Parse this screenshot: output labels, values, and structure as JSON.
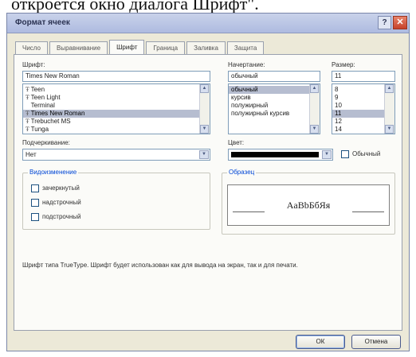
{
  "caption": "откроется окно диалога Шрифт\".",
  "window": {
    "title": "Формат ячеек",
    "help_glyph": "?",
    "close_glyph": "✕"
  },
  "tabs": [
    {
      "label": "Число"
    },
    {
      "label": "Выравнивание"
    },
    {
      "label": "Шрифт"
    },
    {
      "label": "Граница"
    },
    {
      "label": "Заливка"
    },
    {
      "label": "Защита"
    }
  ],
  "font": {
    "label": "Шрифт:",
    "value": "Times New Roman",
    "items": [
      "Teen",
      "Teen Light",
      "Terminal",
      "Times New Roman",
      "Trebuchet MS",
      "Tunga"
    ],
    "selected_index": 3
  },
  "style": {
    "label": "Начертание:",
    "value": "обычный",
    "items": [
      "обычный",
      "курсив",
      "полужирный",
      "полужирный курсив"
    ],
    "selected_index": 0
  },
  "size": {
    "label": "Размер:",
    "value": "11",
    "items": [
      "8",
      "9",
      "10",
      "11",
      "12",
      "14"
    ],
    "selected_index": 3
  },
  "underline": {
    "label": "Подчеркивание:",
    "value": "Нет"
  },
  "color": {
    "label": "Цвет:",
    "value_color": "#000000",
    "normal_label": "Обычный"
  },
  "effects": {
    "title": "Видоизменение",
    "items": [
      "зачеркнутый",
      "надстрочный",
      "подстрочный"
    ]
  },
  "sample": {
    "title": "Образец",
    "text": "AaBbБбЯя"
  },
  "hint": "Шрифт типа TrueType. Шрифт будет использован как для вывода на экран, так и для печати.",
  "buttons": {
    "ok": "ОК",
    "cancel": "Отмена"
  },
  "icons": {
    "truetype": "Ŧ",
    "scroll_up": "▲",
    "scroll_down": "▼",
    "dropdown": "▼"
  }
}
